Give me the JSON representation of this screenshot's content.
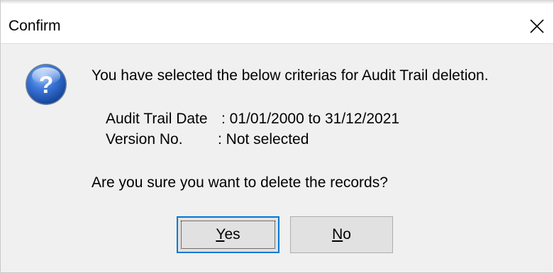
{
  "window": {
    "title": "Confirm"
  },
  "icons": {
    "question": "question-icon",
    "close": "close-icon"
  },
  "message": {
    "intro": "You have selected the below criterias for Audit Trail deletion.",
    "date_label": "Audit Trail Date",
    "date_value": ": 01/01/2000 to 31/12/2021",
    "version_label": "Version No.",
    "version_value": ": Not selected",
    "question": "Are you sure you want to delete the records?"
  },
  "buttons": {
    "yes_accel": "Y",
    "yes_rest": "es",
    "no_accel": "N",
    "no_rest": "o"
  },
  "colors": {
    "dialog_bg": "#f0f0f0",
    "titlebar_bg": "#ffffff",
    "button_bg": "#e1e1e1",
    "focus_border": "#0078d7",
    "icon_blue": "#2a64c5"
  }
}
